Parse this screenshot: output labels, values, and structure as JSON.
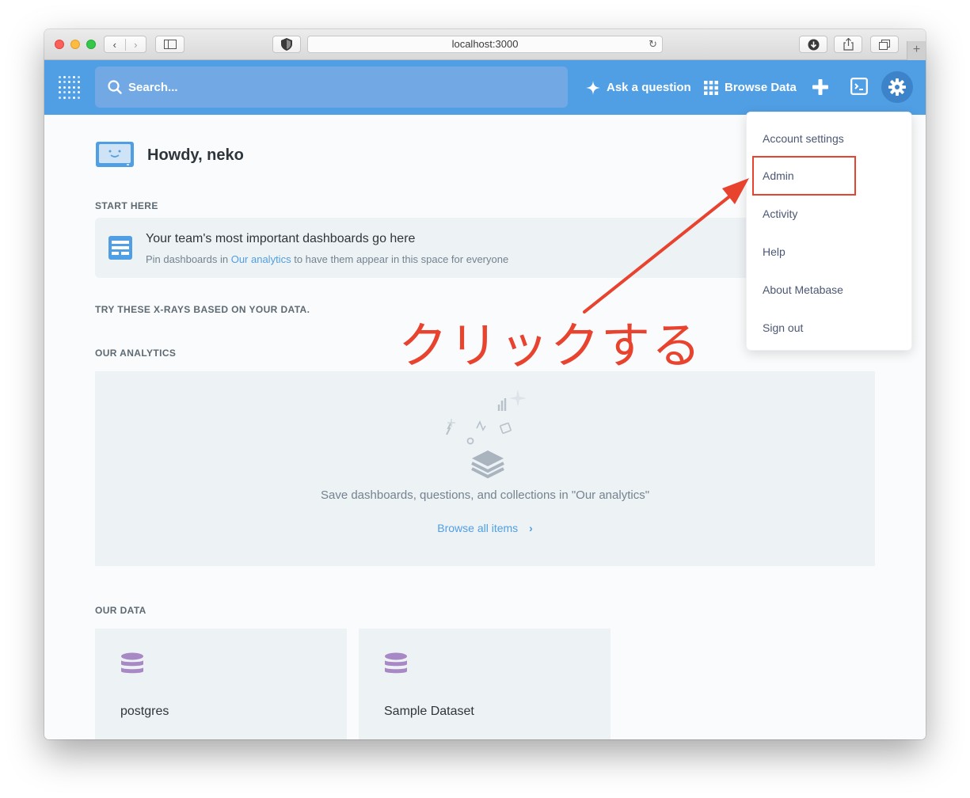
{
  "browser": {
    "address": "localhost:3000"
  },
  "nav": {
    "search_placeholder": "Search...",
    "ask_question": "Ask a question",
    "browse_data": "Browse Data"
  },
  "greeting": "Howdy, neko",
  "start_here": {
    "title": "START HERE",
    "card_title": "Your team's most important dashboards go here",
    "card_desc_prefix": "Pin dashboards in",
    "card_desc_link": "Our analytics",
    "card_desc_suffix": "to have them appear in this space for everyone"
  },
  "xrays_title": "TRY THESE X-RAYS BASED ON YOUR DATA.",
  "our_analytics": {
    "title": "OUR ANALYTICS",
    "empty_text": "Save dashboards, questions, and collections in \"Our analytics\"",
    "browse_all": "Browse all items"
  },
  "our_data": {
    "title": "OUR DATA",
    "databases": [
      {
        "name": "postgres"
      },
      {
        "name": "Sample Dataset"
      }
    ]
  },
  "settings_menu": {
    "items": [
      {
        "label": "Account settings"
      },
      {
        "label": "Admin"
      },
      {
        "label": "Activity"
      },
      {
        "label": "Help"
      },
      {
        "label": "About Metabase"
      },
      {
        "label": "Sign out"
      }
    ]
  },
  "annotation": {
    "text": "クリックする",
    "color": "#e8432f"
  },
  "colors": {
    "brand": "#509ee3",
    "database_icon": "#a989c5"
  }
}
